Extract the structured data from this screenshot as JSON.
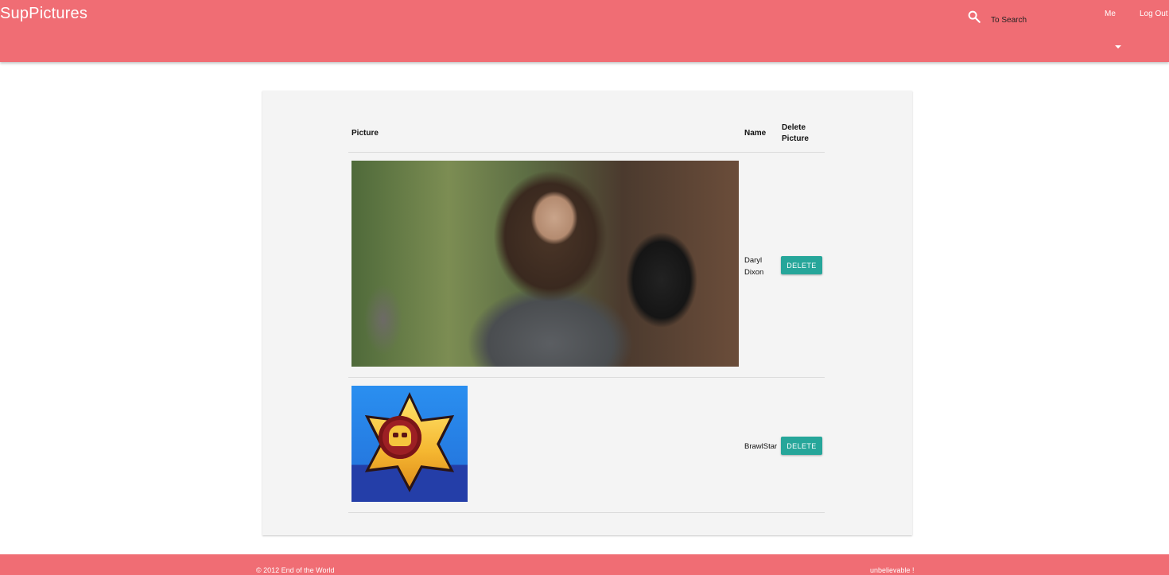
{
  "navbar": {
    "brand": "SupPictures",
    "search": {
      "placeholder": "To Search",
      "value": ""
    },
    "links": {
      "me": "Me",
      "logout": "Log Out"
    }
  },
  "table": {
    "headers": {
      "picture": "Picture",
      "name": "Name",
      "delete": "Delete Picture"
    },
    "rows": [
      {
        "name": "Daryl Dixon",
        "delete_label": "DELETE"
      },
      {
        "name": "BrawlStar",
        "delete_label": "DELETE"
      }
    ]
  },
  "footer": {
    "copyright": "© 2012 End of the World",
    "tagline": "unbelievable !"
  },
  "colors": {
    "navbar": "#f06d74",
    "button": "#26a69a",
    "card": "#f4f4f4"
  },
  "icons": [
    "search-icon",
    "chevron-down-icon"
  ]
}
